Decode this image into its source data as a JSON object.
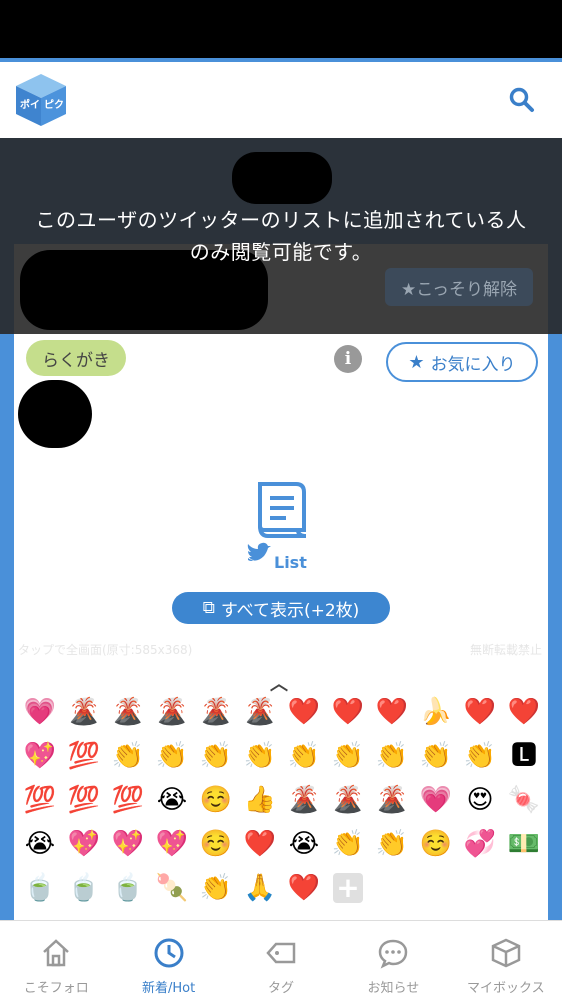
{
  "header": {
    "logo_text": "ポイピク"
  },
  "overlay": {
    "message_line1": "このユーザのツイッターのリストに追加されている人",
    "message_line2": "のみ閲覧可能です。"
  },
  "card": {
    "sneak_button": "★こっそり解除",
    "tag_label": "らくがき",
    "info_icon": "i",
    "favorite_button": "お気に入り",
    "list_label": "List",
    "show_all_button": "すべて表示(+2枚)",
    "tap_note": "タップで全画面(原寸:585x368)",
    "no_repost_note": "無断転載禁止",
    "collapse_icon": "⌃⌃"
  },
  "emoji_reactions": [
    "💗",
    "🌋",
    "🌋",
    "🌋",
    "🌋",
    "🌋",
    "❤️",
    "❤️",
    "❤️",
    "🍌",
    "❤️",
    "❤️",
    "💖",
    "💯",
    "👏",
    "👏",
    "👏",
    "👏",
    "👏",
    "👏",
    "👏",
    "👏",
    "👏",
    "🅻",
    "💯",
    "💯",
    "💯",
    "😭",
    "☺️",
    "👍",
    "🌋",
    "🌋",
    "🌋",
    "💗",
    "😍",
    "🍬",
    "😭",
    "💖",
    "💖",
    "💖",
    "☺️",
    "❤️",
    "😭",
    "👏",
    "👏",
    "☺️",
    "💞",
    "💵",
    "🍵",
    "🍵",
    "🍵",
    "🍡",
    "👏",
    "🙏",
    "❤️"
  ],
  "add_reaction_icon": "+",
  "bottom_nav": [
    {
      "label": "こそフォロ",
      "icon": "home-icon"
    },
    {
      "label": "新着/Hot",
      "icon": "clock-icon"
    },
    {
      "label": "タグ",
      "icon": "tag-icon"
    },
    {
      "label": "お知らせ",
      "icon": "chat-icon"
    },
    {
      "label": "マイボックス",
      "icon": "box-icon"
    }
  ],
  "colors": {
    "accent": "#4a90d9",
    "tag_bg": "#c5de8c",
    "overlay": "#282828"
  }
}
